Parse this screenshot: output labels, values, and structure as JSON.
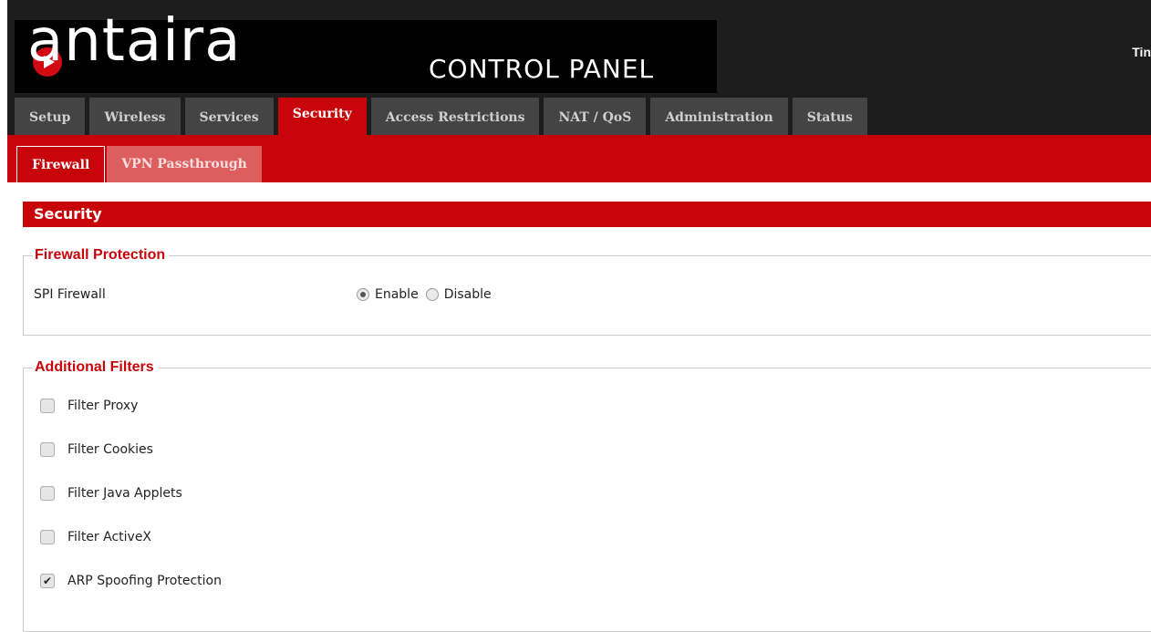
{
  "header": {
    "logo_text": "antaira",
    "subtitle": "CONTROL PANEL",
    "top_right_text": "Tin"
  },
  "nav": {
    "tabs": [
      {
        "label": "Setup",
        "active": false
      },
      {
        "label": "Wireless",
        "active": false
      },
      {
        "label": "Services",
        "active": false
      },
      {
        "label": "Security",
        "active": true
      },
      {
        "label": "Access Restrictions",
        "active": false
      },
      {
        "label": "NAT / QoS",
        "active": false
      },
      {
        "label": "Administration",
        "active": false
      },
      {
        "label": "Status",
        "active": false
      }
    ]
  },
  "subnav": {
    "tabs": [
      {
        "label": "Firewall",
        "active": true
      },
      {
        "label": "VPN Passthrough",
        "active": false
      }
    ]
  },
  "section": {
    "title": "Security"
  },
  "firewall_protection": {
    "legend": "Firewall Protection",
    "spi_label": "SPI Firewall",
    "options": [
      {
        "label": "Enable",
        "checked": true
      },
      {
        "label": "Disable",
        "checked": false
      }
    ]
  },
  "additional_filters": {
    "legend": "Additional Filters",
    "items": [
      {
        "label": "Filter Proxy",
        "checked": false
      },
      {
        "label": "Filter Cookies",
        "checked": false
      },
      {
        "label": "Filter Java Applets",
        "checked": false
      },
      {
        "label": "Filter ActiveX",
        "checked": false
      },
      {
        "label": "ARP Spoofing Protection",
        "checked": true
      }
    ]
  },
  "colors": {
    "brand_red": "#c8040b",
    "header_bg": "#1d1d1d",
    "tab_bg": "#444444",
    "inactive_subtab": "#dd5e5e"
  }
}
